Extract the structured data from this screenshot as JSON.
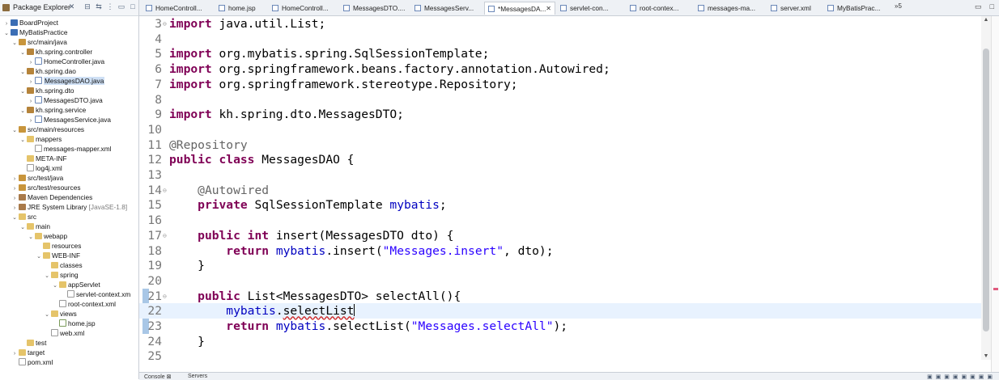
{
  "explorer": {
    "title": "Package Explorer",
    "toolbar_icons": [
      "collapse-all-icon",
      "link-with-editor-icon",
      "view-menu-icon",
      "minimize-icon",
      "maximize-icon"
    ],
    "tree": [
      {
        "depth": 0,
        "expanded": false,
        "icon": "project",
        "label": "BoardProject"
      },
      {
        "depth": 0,
        "expanded": true,
        "icon": "project",
        "label": "MyBatisPractice"
      },
      {
        "depth": 1,
        "expanded": true,
        "icon": "srcfolder",
        "label": "src/main/java"
      },
      {
        "depth": 2,
        "expanded": true,
        "icon": "package",
        "label": "kh.spring.controller"
      },
      {
        "depth": 3,
        "expanded": false,
        "icon": "java",
        "label": "HomeController.java"
      },
      {
        "depth": 2,
        "expanded": true,
        "icon": "package",
        "label": "kh.spring.dao"
      },
      {
        "depth": 3,
        "expanded": false,
        "icon": "java",
        "label": "MessagesDAO.java",
        "selected": true
      },
      {
        "depth": 2,
        "expanded": true,
        "icon": "package",
        "label": "kh.spring.dto"
      },
      {
        "depth": 3,
        "expanded": false,
        "icon": "java",
        "label": "MessagesDTO.java"
      },
      {
        "depth": 2,
        "expanded": true,
        "icon": "package",
        "label": "kh.spring.service"
      },
      {
        "depth": 3,
        "expanded": false,
        "icon": "java",
        "label": "MessagesService.java"
      },
      {
        "depth": 1,
        "expanded": true,
        "icon": "srcfolder",
        "label": "src/main/resources"
      },
      {
        "depth": 2,
        "expanded": true,
        "icon": "folder",
        "label": "mappers"
      },
      {
        "depth": 3,
        "expanded": null,
        "icon": "xml",
        "label": "messages-mapper.xml"
      },
      {
        "depth": 2,
        "expanded": null,
        "icon": "folder",
        "label": "META-INF"
      },
      {
        "depth": 2,
        "expanded": null,
        "icon": "xml",
        "label": "log4j.xml"
      },
      {
        "depth": 1,
        "expanded": false,
        "icon": "srcfolder",
        "label": "src/test/java"
      },
      {
        "depth": 1,
        "expanded": false,
        "icon": "srcfolder",
        "label": "src/test/resources"
      },
      {
        "depth": 1,
        "expanded": false,
        "icon": "lib",
        "label": "Maven Dependencies"
      },
      {
        "depth": 1,
        "expanded": false,
        "icon": "lib",
        "label": "JRE System Library",
        "suffix": "[JavaSE-1.8]"
      },
      {
        "depth": 1,
        "expanded": true,
        "icon": "folder",
        "label": "src"
      },
      {
        "depth": 2,
        "expanded": true,
        "icon": "folder",
        "label": "main"
      },
      {
        "depth": 3,
        "expanded": true,
        "icon": "folder",
        "label": "webapp"
      },
      {
        "depth": 4,
        "expanded": null,
        "icon": "folder",
        "label": "resources"
      },
      {
        "depth": 4,
        "expanded": true,
        "icon": "folder",
        "label": "WEB-INF"
      },
      {
        "depth": 5,
        "expanded": null,
        "icon": "folder",
        "label": "classes"
      },
      {
        "depth": 5,
        "expanded": true,
        "icon": "folder",
        "label": "spring"
      },
      {
        "depth": 6,
        "expanded": true,
        "icon": "folder",
        "label": "appServlet"
      },
      {
        "depth": 7,
        "expanded": null,
        "icon": "xml",
        "label": "servlet-context.xm"
      },
      {
        "depth": 6,
        "expanded": null,
        "icon": "xml",
        "label": "root-context.xml"
      },
      {
        "depth": 5,
        "expanded": true,
        "icon": "folder",
        "label": "views"
      },
      {
        "depth": 6,
        "expanded": null,
        "icon": "jsp",
        "label": "home.jsp"
      },
      {
        "depth": 5,
        "expanded": null,
        "icon": "xml",
        "label": "web.xml"
      },
      {
        "depth": 2,
        "expanded": null,
        "icon": "folder",
        "label": "test"
      },
      {
        "depth": 1,
        "expanded": false,
        "icon": "folder",
        "label": "target"
      },
      {
        "depth": 1,
        "expanded": null,
        "icon": "xml",
        "label": "pom.xml"
      }
    ]
  },
  "tabs": [
    {
      "label": "HomeControll...",
      "icon": "java-file-icon",
      "active": false
    },
    {
      "label": "home.jsp",
      "icon": "jsp-file-icon",
      "active": false
    },
    {
      "label": "HomeControll...",
      "icon": "java-file-icon",
      "active": false
    },
    {
      "label": "MessagesDTO....",
      "icon": "java-file-icon",
      "active": false
    },
    {
      "label": "MessagesServ...",
      "icon": "java-file-icon",
      "active": false
    },
    {
      "label": "*MessagesDA...",
      "icon": "java-file-icon",
      "active": true,
      "close": "✕"
    },
    {
      "label": "servlet-con...",
      "icon": "xml-file-icon",
      "active": false
    },
    {
      "label": "root-contex...",
      "icon": "xml-file-icon",
      "active": false
    },
    {
      "label": "messages-ma...",
      "icon": "xml-file-icon",
      "active": false
    },
    {
      "label": "server.xml",
      "icon": "xml-file-icon",
      "active": false
    },
    {
      "label": "MyBatisPrac...",
      "icon": "java-file-icon",
      "active": false
    }
  ],
  "tab_overflow": "»5",
  "editor": {
    "lines": [
      {
        "n": "3",
        "fold": "⊖",
        "tokens": [
          [
            "kw",
            "import"
          ],
          [
            "t",
            " java.util.List;"
          ]
        ]
      },
      {
        "n": "4",
        "tokens": []
      },
      {
        "n": "5",
        "tokens": [
          [
            "kw",
            "import"
          ],
          [
            "t",
            " org.mybatis.spring.SqlSessionTemplate;"
          ]
        ]
      },
      {
        "n": "6",
        "tokens": [
          [
            "kw",
            "import"
          ],
          [
            "t",
            " org.springframework.beans.factory.annotation.Autowired;"
          ]
        ]
      },
      {
        "n": "7",
        "tokens": [
          [
            "kw",
            "import"
          ],
          [
            "t",
            " org.springframework.stereotype.Repository;"
          ]
        ]
      },
      {
        "n": "8",
        "tokens": []
      },
      {
        "n": "9",
        "tokens": [
          [
            "kw",
            "import"
          ],
          [
            "t",
            " kh.spring.dto.MessagesDTO;"
          ]
        ]
      },
      {
        "n": "10",
        "tokens": []
      },
      {
        "n": "11",
        "tokens": [
          [
            "ann",
            "@Repository"
          ]
        ]
      },
      {
        "n": "12",
        "tokens": [
          [
            "kw",
            "public"
          ],
          [
            "t",
            " "
          ],
          [
            "kw",
            "class"
          ],
          [
            "t",
            " MessagesDAO {"
          ]
        ]
      },
      {
        "n": "13",
        "tokens": []
      },
      {
        "n": "14",
        "fold": "⊖",
        "tokens": [
          [
            "t",
            "    "
          ],
          [
            "ann",
            "@Autowired"
          ]
        ]
      },
      {
        "n": "15",
        "tokens": [
          [
            "t",
            "    "
          ],
          [
            "kw",
            "private"
          ],
          [
            "t",
            " SqlSessionTemplate "
          ],
          [
            "fld",
            "mybatis"
          ],
          [
            "t",
            ";"
          ]
        ]
      },
      {
        "n": "16",
        "tokens": []
      },
      {
        "n": "17",
        "fold": "⊖",
        "tokens": [
          [
            "t",
            "    "
          ],
          [
            "kw",
            "public"
          ],
          [
            "t",
            " "
          ],
          [
            "kw",
            "int"
          ],
          [
            "t",
            " insert(MessagesDTO dto) {"
          ]
        ]
      },
      {
        "n": "18",
        "tokens": [
          [
            "t",
            "        "
          ],
          [
            "kw",
            "return"
          ],
          [
            "t",
            " "
          ],
          [
            "fld",
            "mybatis"
          ],
          [
            "t",
            ".insert("
          ],
          [
            "str",
            "\"Messages.insert\""
          ],
          [
            "t",
            ", dto);"
          ]
        ]
      },
      {
        "n": "19",
        "tokens": [
          [
            "t",
            "    }"
          ]
        ]
      },
      {
        "n": "20",
        "tokens": []
      },
      {
        "n": "21",
        "fold": "⊖",
        "tokens": [
          [
            "t",
            "    "
          ],
          [
            "kw",
            "public"
          ],
          [
            "t",
            " List<MessagesDTO> selectAll(){"
          ]
        ]
      },
      {
        "n": "22",
        "current": true,
        "tokens": [
          [
            "t",
            "        "
          ],
          [
            "fld",
            "mybatis"
          ],
          [
            "t",
            "."
          ],
          [
            "err",
            "selectList"
          ],
          [
            "caret",
            ""
          ]
        ]
      },
      {
        "n": "23",
        "tokens": [
          [
            "t",
            "        "
          ],
          [
            "kw",
            "return"
          ],
          [
            "t",
            " "
          ],
          [
            "fld",
            "mybatis"
          ],
          [
            "t",
            ".selectList("
          ],
          [
            "str",
            "\"Messages.selectAll\""
          ],
          [
            "t",
            ");"
          ]
        ]
      },
      {
        "n": "24",
        "tokens": [
          [
            "t",
            "    }"
          ]
        ]
      },
      {
        "n": "25",
        "tokens": []
      }
    ]
  },
  "bottom": {
    "tabs": [
      "Console ⊠",
      "Servers"
    ]
  }
}
